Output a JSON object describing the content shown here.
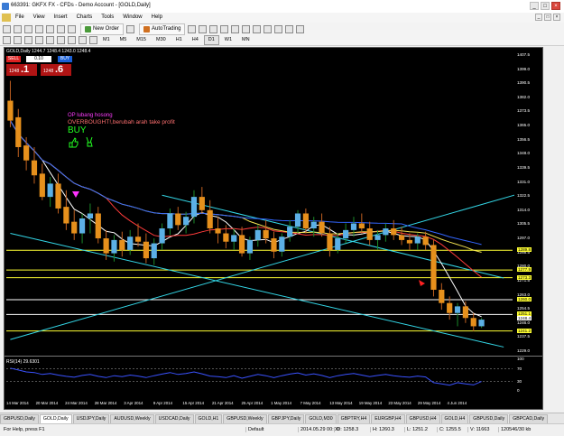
{
  "window": {
    "title": "663391: GKFX FX - CFDs - Demo Account - [GOLD,Daily]"
  },
  "menu": [
    "File",
    "View",
    "Insert",
    "Charts",
    "Tools",
    "Window",
    "Help"
  ],
  "toolbar": {
    "new_order": "New Order",
    "auto_trading": "AutoTrading"
  },
  "timeframes": [
    "M1",
    "M5",
    "M15",
    "M30",
    "H1",
    "H4",
    "D1",
    "W1",
    "MN"
  ],
  "active_timeframe": "D1",
  "chart": {
    "ohlc_text": "GOLD,Daily  1244.7 1248.4 1243.0 1248.4",
    "trade": {
      "sell_label": "SELL",
      "buy_label": "BUY",
      "volume": "0.10",
      "sell_prefix": "1248",
      "sell_big": ".1",
      "buy_prefix": "1248",
      "buy_big": ".6"
    },
    "notes": {
      "line1": "OP lubang hosong",
      "line2": "OVERBOUGHT!,berubah arah take profit",
      "line3": "BUY"
    },
    "rsi_label": "RSI(14) 29.6301",
    "price_axis": [
      "1407.5",
      "1399.0",
      "1390.5",
      "1382.0",
      "1373.5",
      "1365.0",
      "1356.5",
      "1348.0",
      "1339.5",
      "1331.0",
      "1322.5",
      "1314.0",
      "1305.5",
      "1297.0",
      "1288.5",
      "1280.0",
      "1271.5",
      "1263.0",
      "1254.5",
      "1246.0",
      "1237.5",
      "1229.0"
    ],
    "rsi_axis": [
      "100",
      "70",
      "30",
      "0"
    ],
    "date_axis": [
      "14 Mar 2014",
      "20 Mar 2014",
      "24 Mar 2014",
      "28 Mar 2014",
      "3 Apr 2014",
      "9 Apr 2014",
      "15 Apr 2014",
      "21 Apr 2014",
      "25 Apr 2014",
      "1 May 2014",
      "7 May 2014",
      "13 May 2014",
      "19 May 2014",
      "23 May 2014",
      "29 May 2014",
      "4 Jun 2014"
    ],
    "price_tags": [
      "1289.8",
      "1277.9",
      "1273.3",
      "1260.0",
      "1251.1",
      "1248.4",
      "1241.2"
    ]
  },
  "chart_data": {
    "type": "candlestick",
    "title": "GOLD,Daily",
    "ylim": [
      1229.0,
      1407.5
    ],
    "rsi_ylim": [
      0,
      100
    ],
    "dates": [
      "14 Mar 2014",
      "20 Mar 2014",
      "24 Mar 2014",
      "28 Mar 2014",
      "3 Apr 2014",
      "9 Apr 2014",
      "15 Apr 2014",
      "21 Apr 2014",
      "25 Apr 2014",
      "1 May 2014",
      "7 May 2014",
      "13 May 2014",
      "19 May 2014",
      "23 May 2014",
      "29 May 2014",
      "4 Jun 2014"
    ],
    "candles": [
      [
        1380,
        1392,
        1364,
        1368
      ],
      [
        1370,
        1375,
        1346,
        1352
      ],
      [
        1353,
        1358,
        1338,
        1344
      ],
      [
        1344,
        1352,
        1330,
        1335
      ],
      [
        1336,
        1342,
        1320,
        1322
      ],
      [
        1322,
        1334,
        1316,
        1330
      ],
      [
        1330,
        1336,
        1312,
        1315
      ],
      [
        1316,
        1326,
        1302,
        1306
      ],
      [
        1307,
        1314,
        1296,
        1300
      ],
      [
        1300,
        1312,
        1294,
        1309
      ],
      [
        1309,
        1318,
        1300,
        1312
      ],
      [
        1312,
        1316,
        1294,
        1297
      ],
      [
        1297,
        1302,
        1284,
        1288
      ],
      [
        1288,
        1299,
        1283,
        1296
      ],
      [
        1296,
        1301,
        1286,
        1290
      ],
      [
        1290,
        1302,
        1287,
        1298
      ],
      [
        1298,
        1306,
        1292,
        1295
      ],
      [
        1295,
        1300,
        1282,
        1285
      ],
      [
        1285,
        1297,
        1281,
        1294
      ],
      [
        1294,
        1306,
        1290,
        1303
      ],
      [
        1303,
        1315,
        1299,
        1312
      ],
      [
        1312,
        1316,
        1302,
        1305
      ],
      [
        1305,
        1313,
        1300,
        1310
      ],
      [
        1310,
        1326,
        1306,
        1322
      ],
      [
        1322,
        1328,
        1312,
        1314
      ],
      [
        1314,
        1320,
        1300,
        1303
      ],
      [
        1303,
        1310,
        1294,
        1300
      ],
      [
        1300,
        1305,
        1291,
        1295
      ],
      [
        1295,
        1303,
        1290,
        1299
      ],
      [
        1299,
        1304,
        1286,
        1288
      ],
      [
        1288,
        1298,
        1284,
        1296
      ],
      [
        1296,
        1305,
        1292,
        1302
      ],
      [
        1302,
        1308,
        1294,
        1297
      ],
      [
        1297,
        1301,
        1285,
        1289
      ],
      [
        1289,
        1300,
        1286,
        1298
      ],
      [
        1298,
        1308,
        1295,
        1304
      ],
      [
        1304,
        1314,
        1300,
        1312
      ],
      [
        1312,
        1315,
        1300,
        1303
      ],
      [
        1303,
        1310,
        1298,
        1307
      ],
      [
        1307,
        1312,
        1298,
        1300
      ],
      [
        1300,
        1304,
        1286,
        1290
      ],
      [
        1290,
        1300,
        1288,
        1297
      ],
      [
        1297,
        1306,
        1294,
        1302
      ],
      [
        1302,
        1310,
        1298,
        1306
      ],
      [
        1306,
        1312,
        1300,
        1303
      ],
      [
        1303,
        1307,
        1293,
        1296
      ],
      [
        1296,
        1302,
        1290,
        1299
      ],
      [
        1299,
        1306,
        1295,
        1303
      ],
      [
        1303,
        1308,
        1296,
        1299
      ],
      [
        1299,
        1304,
        1293,
        1296
      ],
      [
        1296,
        1300,
        1290,
        1294
      ],
      [
        1294,
        1300,
        1290,
        1298
      ],
      [
        1298,
        1301,
        1290,
        1293
      ],
      [
        1293,
        1296,
        1262,
        1266
      ],
      [
        1266,
        1270,
        1254,
        1258
      ],
      [
        1258,
        1262,
        1248,
        1252
      ],
      [
        1252,
        1258,
        1244,
        1256
      ],
      [
        1256,
        1259,
        1246,
        1249
      ],
      [
        1249,
        1252,
        1241,
        1244
      ],
      [
        1244,
        1249,
        1243,
        1248
      ]
    ],
    "rsi": [
      72,
      66,
      60,
      58,
      52,
      55,
      50,
      46,
      43,
      49,
      52,
      46,
      42,
      48,
      45,
      50,
      47,
      42,
      48,
      53,
      58,
      52,
      55,
      60,
      54,
      47,
      45,
      42,
      48,
      40,
      46,
      52,
      48,
      42,
      48,
      53,
      57,
      50,
      54,
      49,
      42,
      48,
      52,
      55,
      50,
      45,
      49,
      52,
      48,
      45,
      43,
      47,
      44,
      26,
      22,
      18,
      26,
      22,
      19,
      29.6
    ],
    "hlines": [
      1289.8,
      1277.9,
      1273.3,
      1260.0,
      1251.1,
      1241.2
    ],
    "trend_channel_upper": [
      [
        19,
        1323
      ],
      [
        55,
        1281
      ]
    ],
    "trend_channel_lower": [
      [
        0,
        1300
      ],
      [
        55,
        1239
      ]
    ],
    "trend_up": [
      [
        0,
        1236
      ],
      [
        58,
        1316
      ]
    ]
  }
}
